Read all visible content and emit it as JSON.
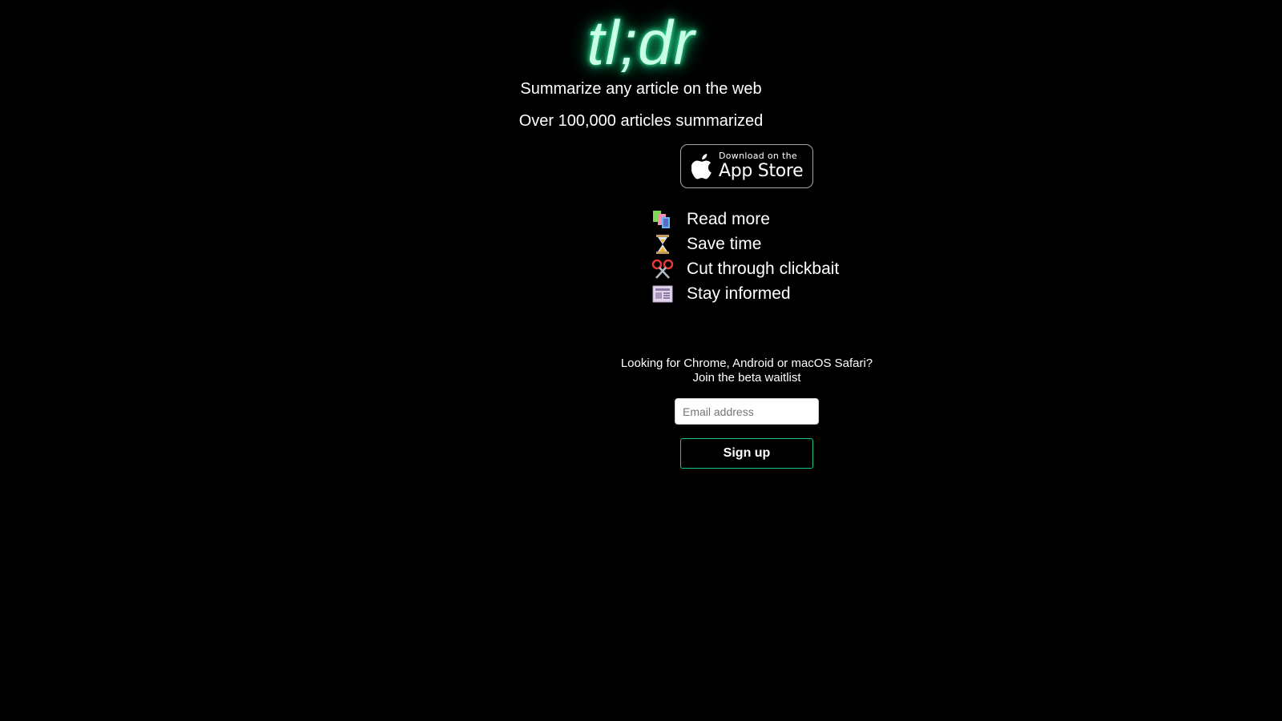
{
  "brand": {
    "logo_text": "tl;dr",
    "glow_color": "#18d98a"
  },
  "hero": {
    "tagline": "Summarize any article on the web",
    "stat": "Over 100,000 articles summarized"
  },
  "app_store_badge": {
    "small_text": "Download on the",
    "big_text": "App Store",
    "icon": "apple-icon"
  },
  "features": [
    {
      "icon": "books-icon",
      "label": "Read more"
    },
    {
      "icon": "hourglass-icon",
      "label": "Save time"
    },
    {
      "icon": "scissors-icon",
      "label": "Cut through clickbait"
    },
    {
      "icon": "newspaper-icon",
      "label": "Stay informed"
    }
  ],
  "waitlist": {
    "line1": "Looking for Chrome, Android or macOS Safari?",
    "line2": "Join the beta waitlist",
    "email_placeholder": "Email address",
    "signup_label": "Sign up",
    "button_border_color": "#12c77e"
  }
}
